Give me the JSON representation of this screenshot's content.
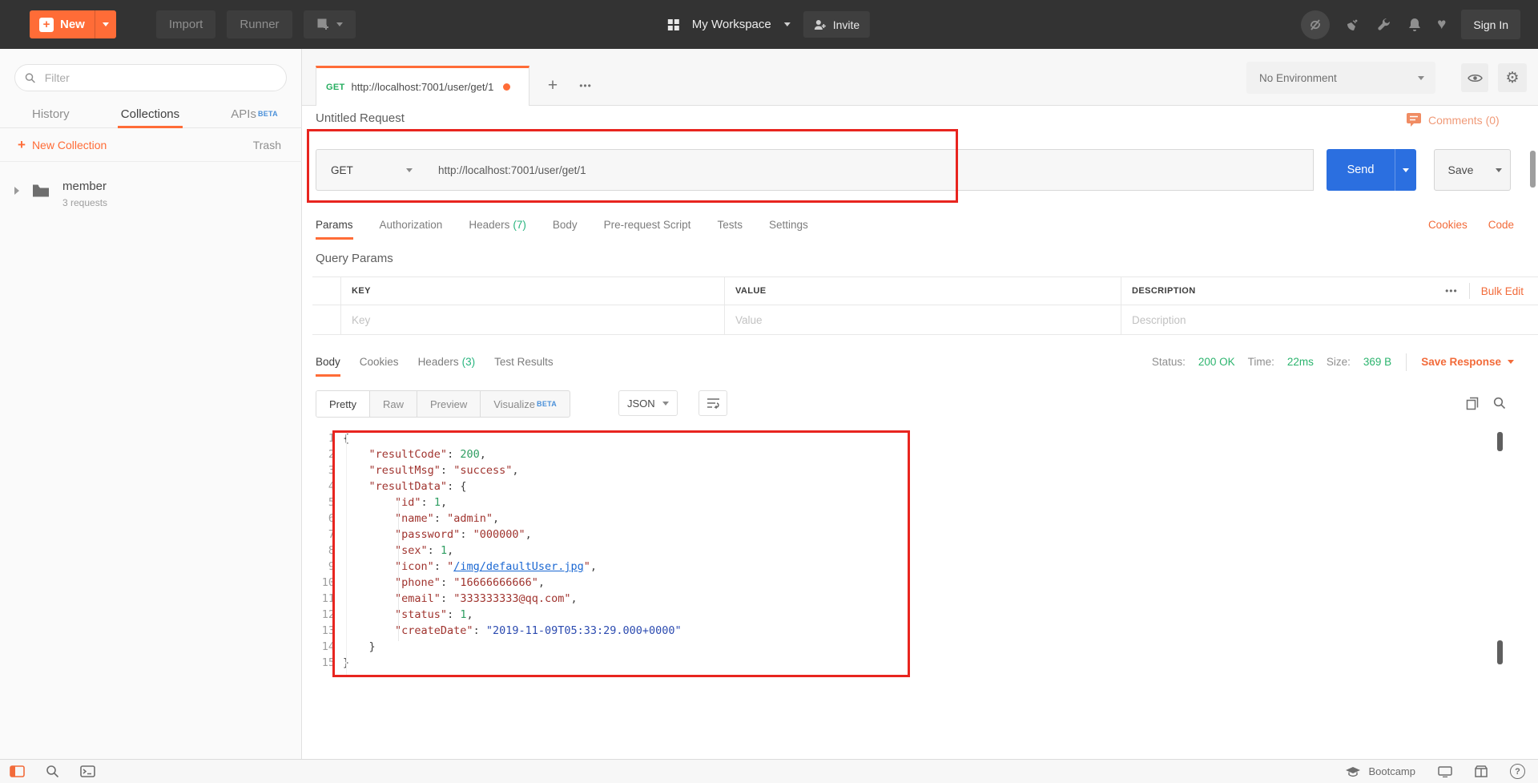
{
  "topbar": {
    "new_label": "New",
    "import_label": "Import",
    "runner_label": "Runner",
    "workspace_label": "My Workspace",
    "invite_label": "Invite",
    "signin_label": "Sign In"
  },
  "sidebar": {
    "filter_placeholder": "Filter",
    "tabs": {
      "history": "History",
      "collections": "Collections",
      "apis": "APIs",
      "apis_badge": "BETA"
    },
    "new_collection_label": "New Collection",
    "trash_label": "Trash",
    "collection": {
      "name": "member",
      "meta": "3 requests"
    }
  },
  "tabstrip": {
    "active_tab": {
      "method": "GET",
      "title": "http://localhost:7001/user/get/1"
    },
    "environment": "No Environment"
  },
  "request": {
    "title": "Untitled Request",
    "comments_label": "Comments (0)",
    "method": "GET",
    "url": "http://localhost:7001/user/get/1",
    "send_label": "Send",
    "save_label": "Save",
    "tabs": {
      "params": "Params",
      "authorization": "Authorization",
      "headers": "Headers",
      "headers_count": "(7)",
      "body": "Body",
      "prerequest": "Pre-request Script",
      "tests": "Tests",
      "settings": "Settings"
    },
    "cookies_link": "Cookies",
    "code_link": "Code"
  },
  "params": {
    "section_title": "Query Params",
    "columns": {
      "key": "KEY",
      "value": "VALUE",
      "description": "DESCRIPTION"
    },
    "placeholders": {
      "key": "Key",
      "value": "Value",
      "description": "Description"
    },
    "bulk_edit_label": "Bulk Edit"
  },
  "response": {
    "tabs": {
      "body": "Body",
      "cookies": "Cookies",
      "headers": "Headers",
      "headers_count": "(3)",
      "test_results": "Test Results"
    },
    "status_label": "Status:",
    "status_value": "200 OK",
    "time_label": "Time:",
    "time_value": "22ms",
    "size_label": "Size:",
    "size_value": "369 B",
    "save_response_label": "Save Response",
    "views": {
      "pretty": "Pretty",
      "raw": "Raw",
      "preview": "Preview",
      "visualize": "Visualize",
      "visualize_badge": "BETA"
    },
    "format": "JSON"
  },
  "code": {
    "lines": [
      {
        "n": "1",
        "t": [
          [
            "pun",
            "{"
          ]
        ]
      },
      {
        "n": "2",
        "t": [
          [
            "pun",
            "    "
          ],
          [
            "key",
            "\"resultCode\""
          ],
          [
            "pun",
            ": "
          ],
          [
            "num",
            "200"
          ],
          [
            "pun",
            ","
          ]
        ]
      },
      {
        "n": "3",
        "t": [
          [
            "pun",
            "    "
          ],
          [
            "key",
            "\"resultMsg\""
          ],
          [
            "pun",
            ": "
          ],
          [
            "str",
            "\"success\""
          ],
          [
            "pun",
            ","
          ]
        ]
      },
      {
        "n": "4",
        "t": [
          [
            "pun",
            "    "
          ],
          [
            "key",
            "\"resultData\""
          ],
          [
            "pun",
            ": {"
          ]
        ]
      },
      {
        "n": "5",
        "t": [
          [
            "pun",
            "        "
          ],
          [
            "key",
            "\"id\""
          ],
          [
            "pun",
            ": "
          ],
          [
            "num",
            "1"
          ],
          [
            "pun",
            ","
          ]
        ]
      },
      {
        "n": "6",
        "t": [
          [
            "pun",
            "        "
          ],
          [
            "key",
            "\"name\""
          ],
          [
            "pun",
            ": "
          ],
          [
            "str",
            "\"admin\""
          ],
          [
            "pun",
            ","
          ]
        ]
      },
      {
        "n": "7",
        "t": [
          [
            "pun",
            "        "
          ],
          [
            "key",
            "\"password\""
          ],
          [
            "pun",
            ": "
          ],
          [
            "str",
            "\"000000\""
          ],
          [
            "pun",
            ","
          ]
        ]
      },
      {
        "n": "8",
        "t": [
          [
            "pun",
            "        "
          ],
          [
            "key",
            "\"sex\""
          ],
          [
            "pun",
            ": "
          ],
          [
            "num",
            "1"
          ],
          [
            "pun",
            ","
          ]
        ]
      },
      {
        "n": "9",
        "t": [
          [
            "pun",
            "        "
          ],
          [
            "key",
            "\"icon\""
          ],
          [
            "pun",
            ": "
          ],
          [
            "str",
            "\""
          ],
          [
            "link",
            "/img/defaultUser.jpg"
          ],
          [
            "str",
            "\""
          ],
          [
            "pun",
            ","
          ]
        ]
      },
      {
        "n": "10",
        "t": [
          [
            "pun",
            "        "
          ],
          [
            "key",
            "\"phone\""
          ],
          [
            "pun",
            ": "
          ],
          [
            "str",
            "\"16666666666\""
          ],
          [
            "pun",
            ","
          ]
        ]
      },
      {
        "n": "11",
        "t": [
          [
            "pun",
            "        "
          ],
          [
            "key",
            "\"email\""
          ],
          [
            "pun",
            ": "
          ],
          [
            "str",
            "\"333333333@qq.com\""
          ],
          [
            "pun",
            ","
          ]
        ]
      },
      {
        "n": "12",
        "t": [
          [
            "pun",
            "        "
          ],
          [
            "key",
            "\"status\""
          ],
          [
            "pun",
            ": "
          ],
          [
            "num",
            "1"
          ],
          [
            "pun",
            ","
          ]
        ]
      },
      {
        "n": "13",
        "t": [
          [
            "pun",
            "        "
          ],
          [
            "key",
            "\"createDate\""
          ],
          [
            "pun",
            ": "
          ],
          [
            "date",
            "\"2019-11-09T05:33:29.000+0000\""
          ]
        ]
      },
      {
        "n": "14",
        "t": [
          [
            "pun",
            "    }"
          ]
        ]
      },
      {
        "n": "15",
        "t": [
          [
            "pun",
            "}"
          ]
        ]
      }
    ]
  },
  "statusbar": {
    "bootcamp_label": "Bootcamp"
  },
  "icons": {
    "ellipsis": "•••",
    "plus": "+",
    "chevron_right": "▸",
    "heart": "♥",
    "gear": "⚙",
    "question": "?"
  },
  "colors": {
    "accent_orange": "#ff6c37",
    "annotation_red": "#e8251f",
    "success_green": "#2cb46e",
    "send_blue": "#2b6fe0",
    "link_blue": "#1a67d2",
    "key_red": "#a0342f",
    "number_green": "#2f9e62",
    "date_navy": "#2c4bb0"
  }
}
